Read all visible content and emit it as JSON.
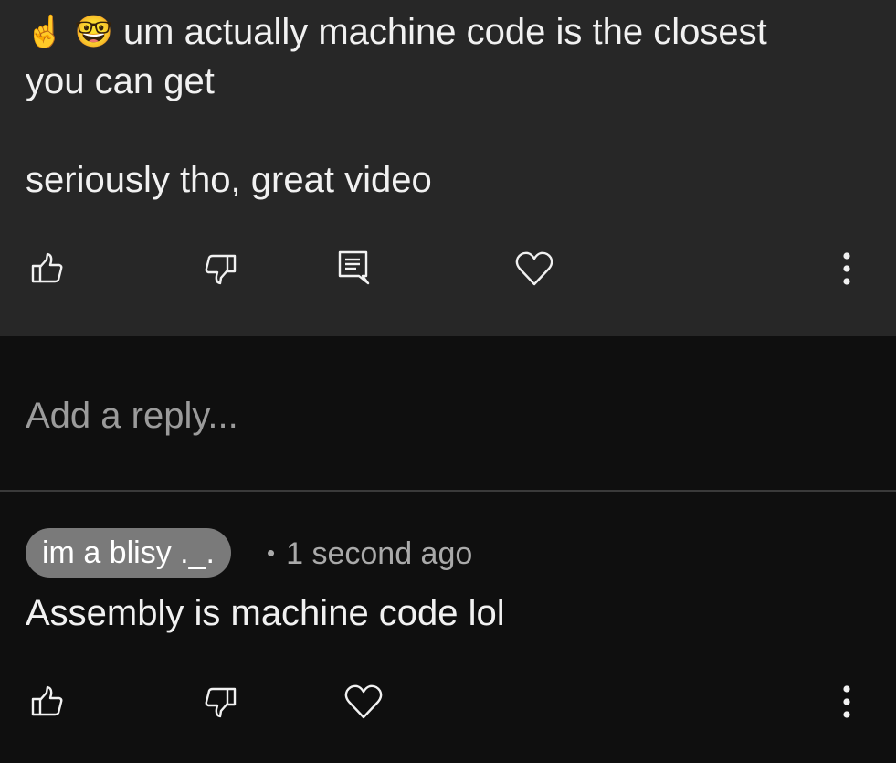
{
  "top_comment": {
    "emojis": [
      "☝️",
      "🤓"
    ],
    "line1": "um actually machine code is the closest",
    "line2": "you can get",
    "line3": "seriously tho, great video",
    "actions": {
      "like_icon": "thumbs-up-icon",
      "dislike_icon": "thumbs-down-icon",
      "reply_icon": "comment-icon",
      "heart_icon": "heart-icon",
      "more_icon": "more-vertical-icon"
    }
  },
  "add_reply": {
    "placeholder": "Add a reply..."
  },
  "reply": {
    "author": "im a blisy ._.",
    "separator": "•",
    "timestamp": "1 second ago",
    "text": "Assembly is machine code lol",
    "actions": {
      "like_icon": "thumbs-up-icon",
      "dislike_icon": "thumbs-down-icon",
      "heart_icon": "heart-icon",
      "more_icon": "more-vertical-icon"
    }
  },
  "colors": {
    "highlight_bg": "#272727",
    "page_bg": "#0f0f0f",
    "text": "#f1f1f1",
    "muted": "#aaaaaa",
    "chip_bg": "#7a7a7a"
  }
}
